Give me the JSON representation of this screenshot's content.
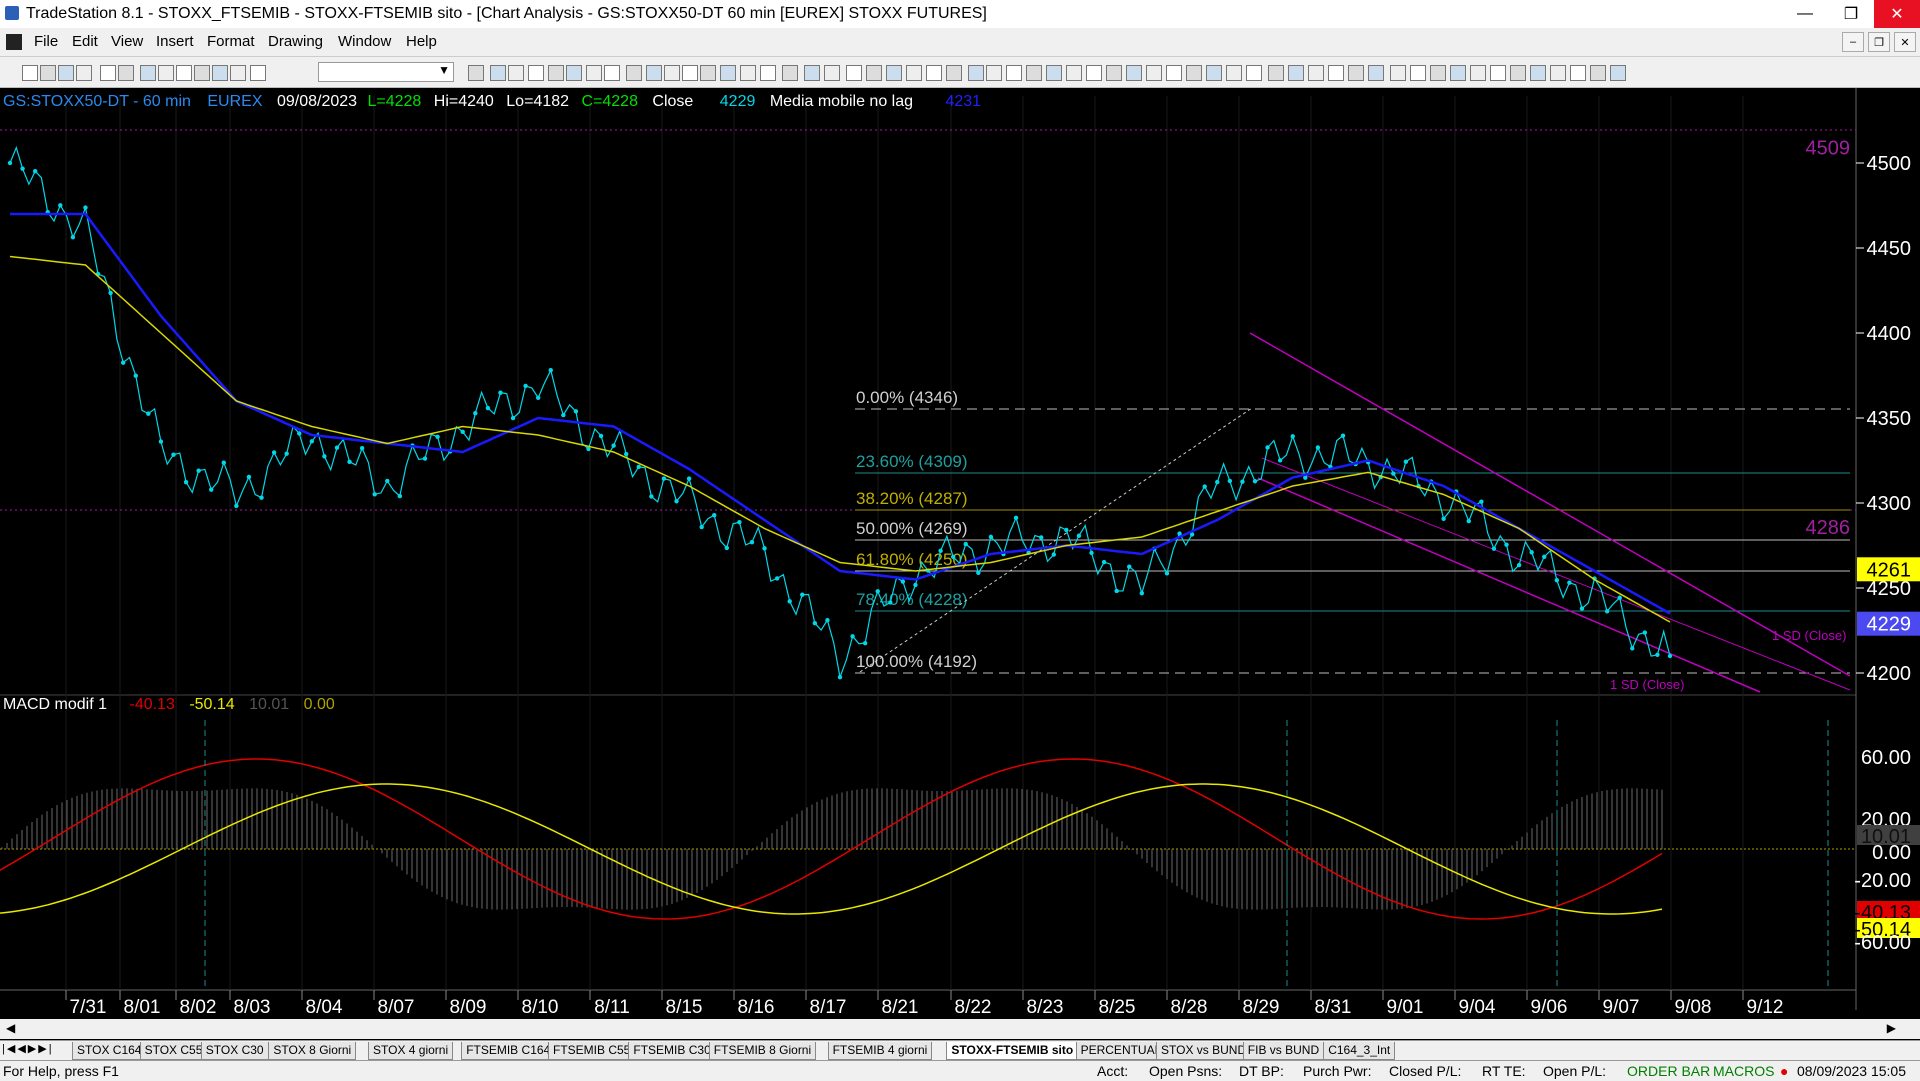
{
  "window": {
    "title": "TradeStation 8.1 - STOXX_FTSEMIB - STOXX-FTSEMIB sito - [Chart Analysis - GS:STOXX50-DT  60 min  [EUREX] STOXX FUTURES]",
    "controls": {
      "minimize": "—",
      "restore": "❐",
      "close": "✕"
    },
    "mdi_controls": {
      "minimize": "–",
      "restore": "❐",
      "close": "✕"
    }
  },
  "menu": [
    "File",
    "Edit",
    "View",
    "Insert",
    "Format",
    "Drawing",
    "Window",
    "Help"
  ],
  "toolbar": {
    "symbol_combo_value": ""
  },
  "header": {
    "symbol": "GS:STOXX50-DT - 60 min",
    "exchange": "EUREX",
    "date": "09/08/2023",
    "low": "L=4228",
    "high": "Hi=4240",
    "low2": "Lo=4182",
    "close": "C=4228",
    "close_label": "Close",
    "close_value": "4229",
    "indicator": "Media mobile no lag",
    "indicator_value": "4231"
  },
  "price_axis": {
    "ticks": [
      "4500",
      "4450",
      "4400",
      "4350",
      "4300",
      "4250",
      "4200"
    ],
    "markers": [
      {
        "label": "4509",
        "color": "#a020a0",
        "bg": "none"
      },
      {
        "label": "4286",
        "color": "#a020a0",
        "bg": "none"
      },
      {
        "label": "4261",
        "color": "#000",
        "bg": "#ffff00"
      },
      {
        "label": "4229",
        "color": "#fff",
        "bg": "#4a4af0"
      }
    ]
  },
  "fibonacci": [
    {
      "label": "0.00% (4346)",
      "color": "#d0d0d0"
    },
    {
      "label": "23.60% (4309)",
      "color": "#1fa0a0"
    },
    {
      "label": "38.20% (4287)",
      "color": "#c0b000"
    },
    {
      "label": "50.00% (4269)",
      "color": "#d0d0d0"
    },
    {
      "label": "61.80% (4250)",
      "color": "#c0b000"
    },
    {
      "label": "78.40% (4228)",
      "color": "#1fa0a0"
    },
    {
      "label": "100.00% (4192)",
      "color": "#d0d0d0"
    }
  ],
  "channel_labels": [
    "1 SD (Close)",
    "1 SD (Close)"
  ],
  "macd": {
    "title": "MACD modif 1",
    "v1": "-40.13",
    "v2": "-50.14",
    "v3": "10.01",
    "v4": "0.00",
    "ticks": [
      "60.00",
      "20.00",
      "10.01",
      "0.00",
      "-20.00",
      "-40.13",
      "-50.14",
      "-60.00"
    ]
  },
  "date_axis": [
    "7/31",
    "8/01",
    "8/02",
    "8/03",
    "8/04",
    "8/07",
    "8/09",
    "8/10",
    "8/11",
    "8/15",
    "8/16",
    "8/17",
    "8/21",
    "8/22",
    "8/23",
    "8/25",
    "8/28",
    "8/29",
    "8/31",
    "9/01",
    "9/04",
    "9/06",
    "9/07",
    "9/08",
    "9/12"
  ],
  "tabs": [
    "STOX C164",
    "STOX C55",
    "STOX  C30",
    "STOX  8 Giorni",
    "STOX 4 giorni",
    "FTSEMIB C164",
    "FTSEMIB C55",
    "FTSEMIB C30",
    "FTSEMIB  8 Giorni",
    "FTSEMIB  4 giorni",
    "STOXX-FTSEMIB sito",
    "PERCENTUALE",
    "STOX vs BUND",
    "FIB vs BUND",
    "C164_3_Int"
  ],
  "active_tab": "STOXX-FTSEMIB sito",
  "status": {
    "help": "For Help, press F1",
    "acct": "Acct:",
    "open_psns": "Open Psns:",
    "dt_bp": "DT BP:",
    "purch_pwr": "Purch Pwr:",
    "closed_pl": "Closed P/L:",
    "rt_te": "RT TE:",
    "open_pl": "Open P/L:",
    "order_bar": "ORDER BAR",
    "macros": "MACROS",
    "datetime": "08/09/2023 15:05"
  },
  "colors": {
    "price_line": "#00d8e8",
    "avg_blue": "#1a1aff",
    "avg_yellow": "#d8d800",
    "channel": "#c000c0",
    "macd_red": "#e00000",
    "macd_yellow": "#e8e800"
  },
  "chart_data": {
    "type": "line",
    "title": "",
    "xlabel": "",
    "ylabel": "",
    "ylim": [
      4185,
      4515
    ],
    "x": [
      "7/31",
      "8/01",
      "8/02",
      "8/03",
      "8/04",
      "8/07",
      "8/09",
      "8/10",
      "8/11",
      "8/15",
      "8/16",
      "8/17",
      "8/21",
      "8/22",
      "8/23",
      "8/25",
      "8/28",
      "8/29",
      "8/31",
      "9/01",
      "9/04",
      "9/06",
      "9/07"
    ],
    "series": [
      {
        "values": [
          4500,
          4460,
          4330,
          4305,
          4340,
          4310,
          4345,
          4370,
          4330,
          4300,
          4270,
          4210,
          4260,
          4275,
          4280,
          4250,
          4310,
          4330,
          4325,
          4305,
          4270,
          4245,
          4210
        ]
      },
      {
        "values": [
          4470,
          4470,
          4410,
          4360,
          4340,
          4335,
          4330,
          4350,
          4345,
          4320,
          4290,
          4260,
          4255,
          4270,
          4275,
          4270,
          4290,
          4315,
          4325,
          4310,
          4285,
          4260,
          4235
        ]
      },
      {
        "values": [
          4445,
          4440,
          4400,
          4360,
          4345,
          4335,
          4345,
          4340,
          4330,
          4310,
          4285,
          4265,
          4260,
          4265,
          4275,
          4280,
          4295,
          4310,
          4318,
          4305,
          4285,
          4255,
          4230
        ]
      }
    ]
  }
}
